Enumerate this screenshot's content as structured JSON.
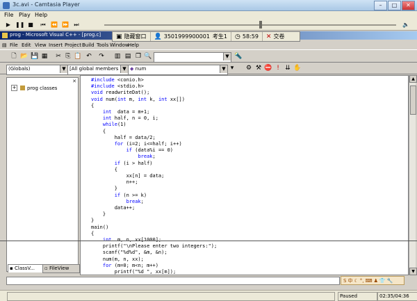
{
  "player": {
    "title": "3c.avi - Camtasia Player",
    "menu": [
      "File",
      "Play",
      "Help"
    ],
    "controls": [
      "play-icon",
      "pause-icon",
      "stop-icon",
      "skip-back-icon",
      "rewind-icon",
      "fast-forward-icon",
      "skip-forward-icon"
    ],
    "progress": 0.53,
    "status": "Paused",
    "time": "02:35/04:36"
  },
  "vc": {
    "title": "prog - Microsoft Visual C++ - [prog.c]",
    "menu": [
      "File",
      "Edit",
      "View",
      "Insert",
      "Project",
      "Build",
      "Tools",
      "Window",
      "Help"
    ],
    "globals_combo": "(Globals)",
    "members_combo": "[All global members",
    "function_combo": "num",
    "workspace_tree_item": "prog classes",
    "workspace_tabs": [
      "ClassV...",
      "FileView"
    ],
    "code_lines": [
      "#include <conio.h>",
      "#include <stdio.h>",
      "void readwriteDat();",
      "void num(int m, int k, int xx[])",
      "{",
      "    int  data = m+1;",
      "    int half, n = 0, i;",
      "    while(1)",
      "    {",
      "        half = data/2;",
      "        for (i=2; i<=half; i++)",
      "            if (data%i == 0)",
      "                break;",
      "        if (i > half)",
      "        {",
      "            xx[n] = data;",
      "            n++;",
      "        }",
      "        if (n >= k)",
      "            break;",
      "        data++;",
      "    }",
      "}",
      "main()",
      "{",
      "    int  m, n, xx[1000];",
      "    printf(\"\\nPlease enter two integers:\");",
      "    scanf(\"%d%d\", &m, &n);",
      "    num(m, n, xx);",
      "    for (m=0; m<n; m++)",
      "        printf(\"%d \", xx[m]);"
    ]
  },
  "exam_bar": {
    "window_label": "隐藏窗口",
    "exam_id": "3501999900001",
    "candidate": "考生1",
    "timer": "58:59",
    "submit": "交卷"
  }
}
